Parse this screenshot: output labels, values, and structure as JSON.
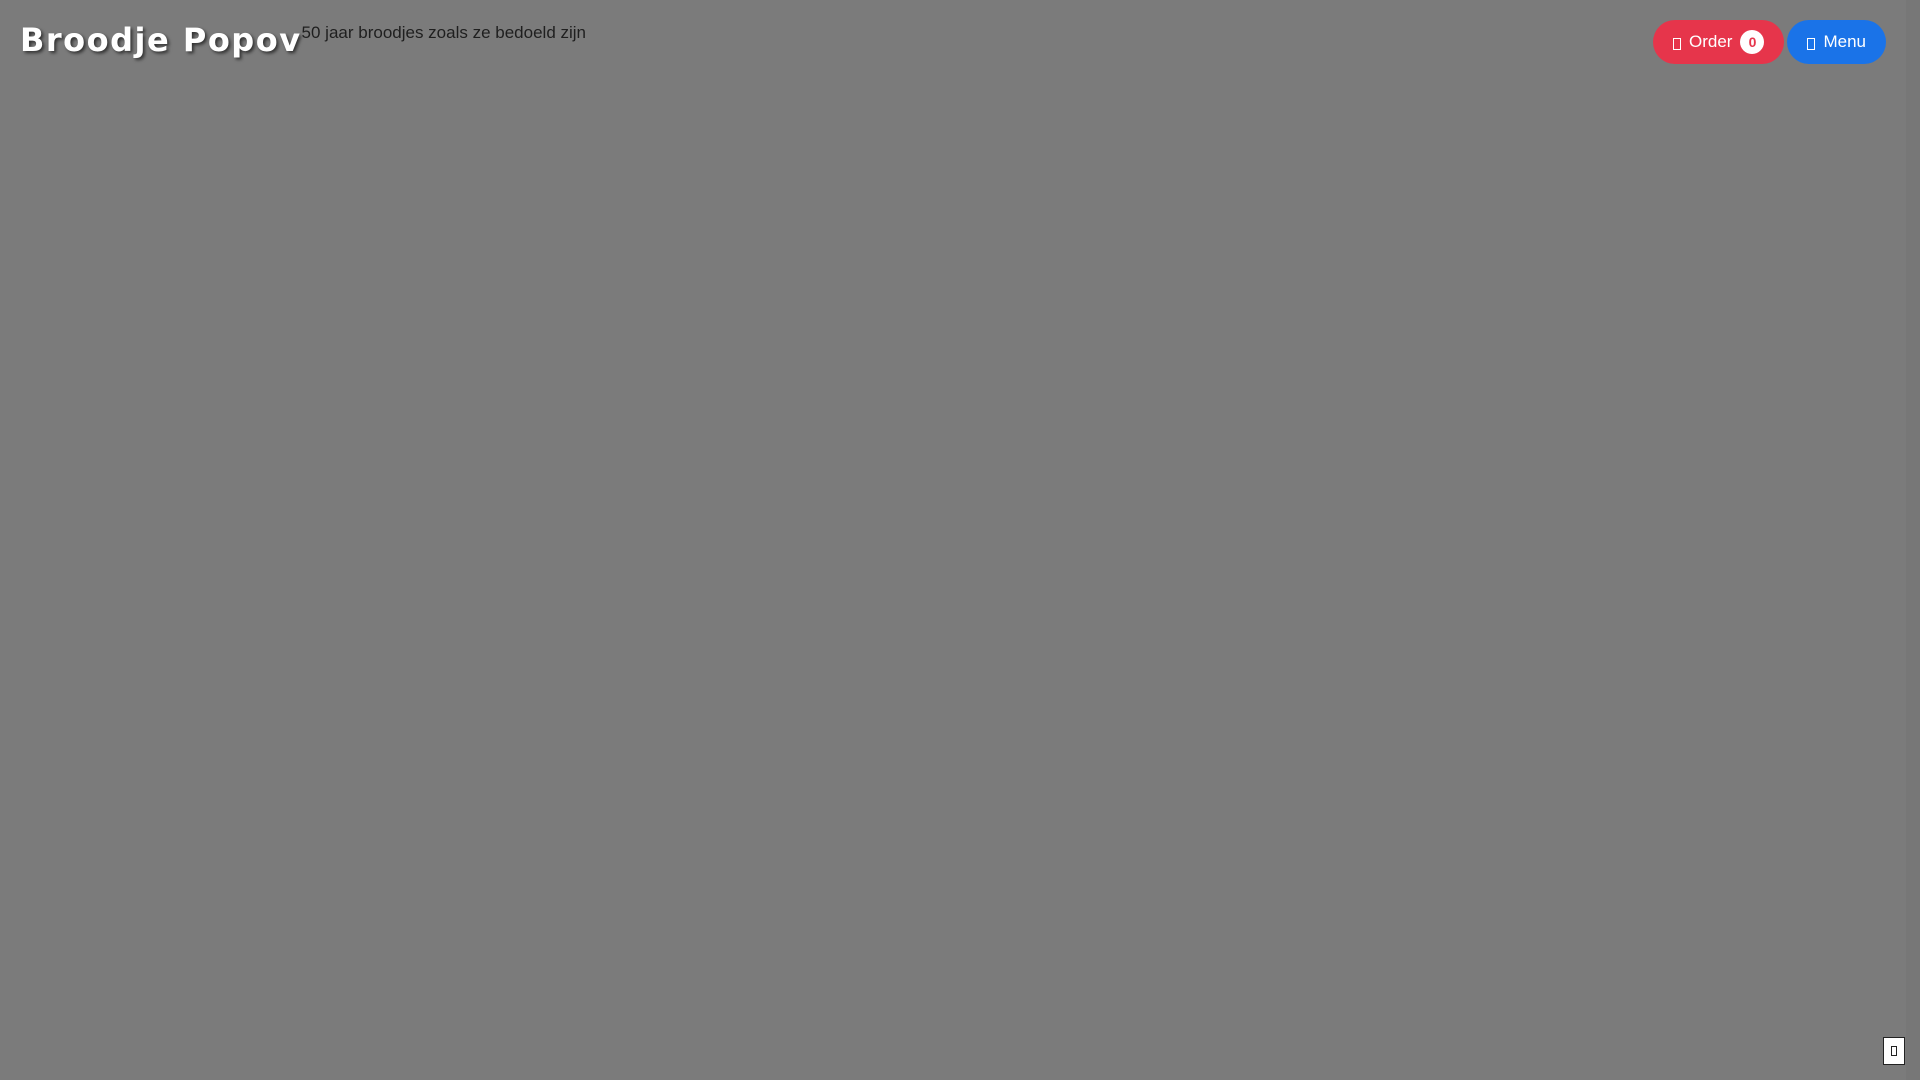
{
  "brand": {
    "title": "Broodje Popov",
    "tagline": "50 jaar broodjes zoals ze bedoeld zijn"
  },
  "actions": {
    "order": {
      "label": "Order",
      "icon": "cart-icon",
      "count": "0"
    },
    "menu": {
      "label": "Menu",
      "icon": "menu-icon"
    }
  },
  "back_to_top": {
    "icon": "arrow-up-icon"
  },
  "colors": {
    "background": "#7b7b7b",
    "order_button": "#e6354b",
    "menu_button": "#1a73e8"
  }
}
